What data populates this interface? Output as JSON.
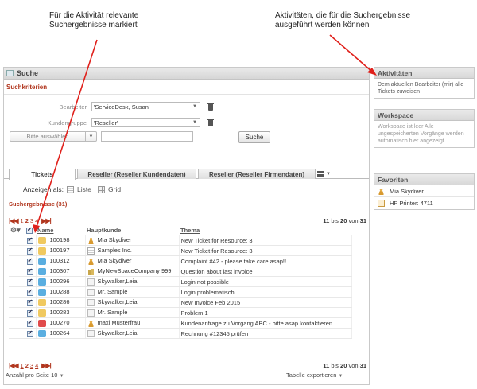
{
  "annotations": {
    "left": [
      "Für die Aktivität relevante",
      "Suchergebnisse markiert"
    ],
    "right": [
      "Aktivitäten, die für die Suchergebnisse",
      "ausgeführt werden können"
    ]
  },
  "colors": {
    "accent": "#b1361e",
    "arrow": "#e0201b"
  },
  "panel": {
    "title": "Suche",
    "criteria_title": "Suchkriterien",
    "criteria": [
      {
        "label": "Bearbeiter",
        "value": "'ServiceDesk, Susan'"
      },
      {
        "label": "Kundengruppe",
        "value": "'Reseller'"
      }
    ],
    "add_criteria_placeholder": "Bitte auswählen",
    "search_button": "Suche"
  },
  "tabs": [
    "Tickets",
    "Reseller (Reseller Kundendaten)",
    "Reseller (Reseller Firmendaten)"
  ],
  "view": {
    "label": "Anzeigen als:",
    "list": "Liste",
    "grid": "Grid"
  },
  "results": {
    "title": "Suchergebnisse (31)",
    "pages": [
      "1",
      "2",
      "3",
      "4"
    ],
    "current_page": "2",
    "range_from": "11",
    "range_mid": "bis",
    "range_to": "20",
    "range_of": "von",
    "total": "31",
    "columns": {
      "name": "Name",
      "customer": "Hauptkunde",
      "topic": "Thema"
    },
    "rows": [
      {
        "id": "100198",
        "icon_color": "#f0c960",
        "customer": "Mia Skydiver",
        "customer_icon": "person",
        "topic": "New Ticket for Resource: 3"
      },
      {
        "id": "100197",
        "icon_color": "#f0c960",
        "customer": "Samples Inc.",
        "customer_icon": "doc",
        "topic": "New Ticket for Resource: 3"
      },
      {
        "id": "100312",
        "icon_color": "#5aaee0",
        "customer": "Mia Skydiver",
        "customer_icon": "person",
        "topic": "Complaint #42 - please take care asap!!"
      },
      {
        "id": "100307",
        "icon_color": "#5aaee0",
        "customer": "MyNewSpaceCompany 999",
        "customer_icon": "building",
        "topic": "Question about last invoice"
      },
      {
        "id": "100296",
        "icon_color": "#5aaee0",
        "customer": "Skywalker,Leia",
        "customer_icon": "plain",
        "topic": "Login not possible"
      },
      {
        "id": "100288",
        "icon_color": "#5aaee0",
        "customer": "Mr. Sample",
        "customer_icon": "plain",
        "topic": "Login problematisch"
      },
      {
        "id": "100286",
        "icon_color": "#f0c960",
        "customer": "Skywalker,Leia",
        "customer_icon": "plain",
        "topic": "New Invoice Feb 2015"
      },
      {
        "id": "100283",
        "icon_color": "#f0c960",
        "customer": "Mr. Sample",
        "customer_icon": "plain",
        "topic": "Problem 1"
      },
      {
        "id": "100270",
        "icon_color": "#e04a4a",
        "customer": "maxi Musterfrau",
        "customer_icon": "person",
        "topic": "Kundenanfrage zu Vorgang ABC - bitte asap kontaktieren"
      },
      {
        "id": "100264",
        "icon_color": "#5aaee0",
        "customer": "Skywalker,Leia",
        "customer_icon": "plain",
        "topic": "Rechnung #12345 prüfen"
      }
    ],
    "per_page_label": "Anzahl pro Seite",
    "per_page_value": "10",
    "export_label": "Tabelle exportieren"
  },
  "side": {
    "activities": {
      "title": "Aktivitäten",
      "text": "Dem aktuellen Bearbeiter (mir) alle Tickets zuweisen"
    },
    "workspace": {
      "title": "Workspace",
      "text": "Workspace ist leer Alle ungespeicherten Vorgänge werden automatisch hier angezeigt."
    },
    "favorites": {
      "title": "Favoriten",
      "items": [
        "Mia Skydiver",
        "HP Printer: 4711"
      ]
    }
  }
}
